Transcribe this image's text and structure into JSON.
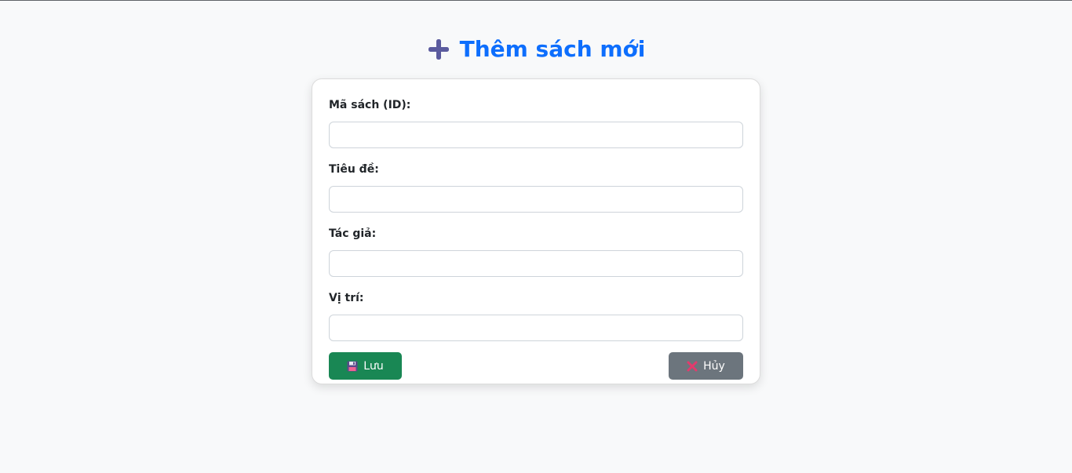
{
  "header": {
    "title": "Thêm sách mới",
    "icon": "plus-icon",
    "title_color": "#0d6efd",
    "icon_color": "#5b5b9e"
  },
  "form": {
    "fields": [
      {
        "label": "Mã sách (ID):",
        "value": "",
        "placeholder": ""
      },
      {
        "label": "Tiêu đề:",
        "value": "",
        "placeholder": ""
      },
      {
        "label": "Tác giả:",
        "value": "",
        "placeholder": ""
      },
      {
        "label": "Vị trí:",
        "value": "",
        "placeholder": ""
      }
    ],
    "save_button": {
      "label": "Lưu",
      "icon": "floppy-disk-icon",
      "color": "#198754"
    },
    "cancel_button": {
      "label": "Hủy",
      "icon": "cross-icon",
      "color": "#6c757d"
    }
  }
}
